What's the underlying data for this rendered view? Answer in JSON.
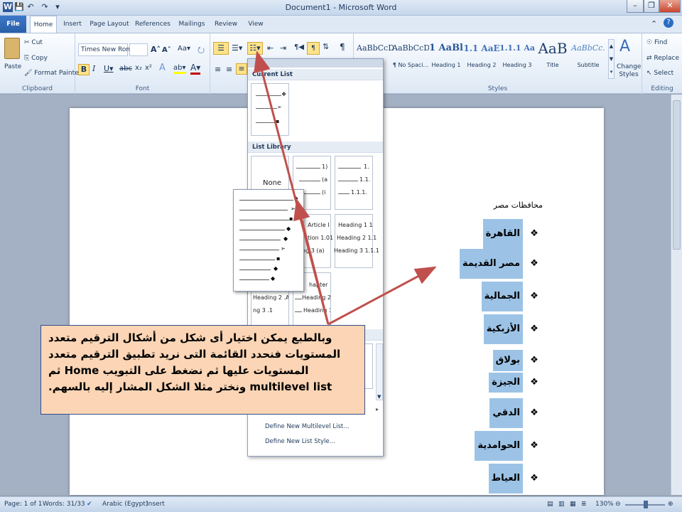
{
  "titlebar": {
    "title": "Document1 - Microsoft Word"
  },
  "tabs": [
    "File",
    "Home",
    "Insert",
    "Page Layout",
    "References",
    "Mailings",
    "Review",
    "View"
  ],
  "clipboard": {
    "paste": "Paste",
    "cut": "Cut",
    "copy": "Copy",
    "format_painter": "Format Painter",
    "label": "Clipboard"
  },
  "font": {
    "name": "Times New Rom",
    "label": "Font"
  },
  "paragraph": {
    "label": "Paragraph"
  },
  "styles": {
    "label": "Styles",
    "tiles": [
      {
        "preview": "AaBbCcDc",
        "name": ""
      },
      {
        "preview": "AaBbCcDc",
        "name": "¶ No Spaci..."
      },
      {
        "preview": "1 AaBl",
        "name": "Heading 1"
      },
      {
        "preview": "1.1 AaE",
        "name": "Heading 2"
      },
      {
        "preview": "1.1.1 Aa",
        "name": "Heading 3"
      },
      {
        "preview": "AaB",
        "name": "Title"
      },
      {
        "preview": "AaBbCc.",
        "name": "Subtitle"
      }
    ],
    "change_styles": "Change Styles"
  },
  "editing": {
    "find": "Find",
    "replace": "Replace",
    "select": "Select",
    "label": "Editing"
  },
  "dropdown": {
    "current_list": "Current List",
    "list_library": "List Library",
    "none": "None",
    "lib1": [
      "1)",
      "(a",
      "(i"
    ],
    "lib2": [
      "1.",
      "1.1.",
      "1.1.1."
    ],
    "lib3": [
      "Article I",
      "ction 1.01",
      "ng 3 (a)"
    ],
    "lib4": [
      "Heading 1 1",
      "Heading 2 1.1",
      "Heading 3 1.1.1"
    ],
    "lib5": [
      "hapter 1",
      "Heading 2",
      "Heading 3"
    ],
    "lib6": [
      "Heading 2 .A",
      "ng 3 .1"
    ],
    "define_multilevel": "Define New Multilevel List...",
    "define_style": "Define New List Style..."
  },
  "document": {
    "heading": "محافظات مصر",
    "items": [
      "القاهرة",
      "مصر القديمة",
      "الجمالية",
      "الأزبكية",
      "بولاق",
      "الجيزة",
      "الدقي",
      "الحوامدية",
      "العياط"
    ]
  },
  "callout": {
    "text": "وبالطبع يمكن اختيار أى شكل من أشكال الترقيم متعدد المستويات فنحدد القائمة التى نريد تطبيق الترقيم متعدد المستويات عليها ثم نضغط على التبويب Home ثم multilevel list ونختر مثلا الشكل المشار إليه بالسهم."
  },
  "status": {
    "page": "Page: 1 of 1",
    "words": "Words: 31/33",
    "language": "Arabic (Egypt)",
    "mode": "Insert",
    "zoom": "130%"
  }
}
